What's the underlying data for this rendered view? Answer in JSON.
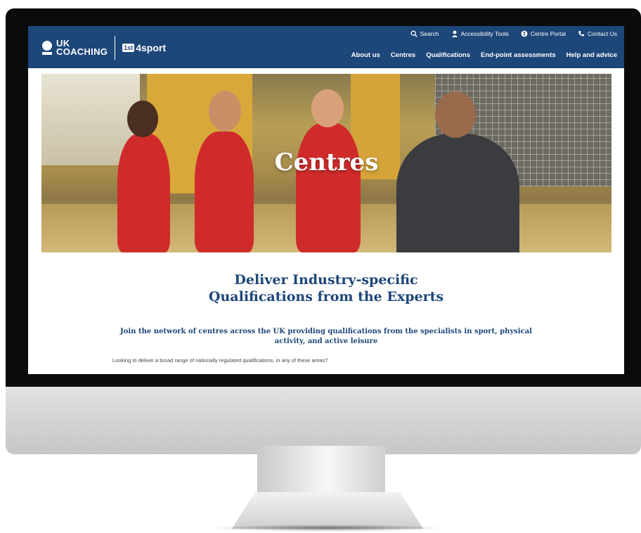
{
  "brand": {
    "uk_line1": "UK",
    "uk_line2": "COACHING",
    "badge": "1st",
    "name": "4sport"
  },
  "util_nav": [
    {
      "label": "Search",
      "icon": "search-icon"
    },
    {
      "label": "Accessibility Tools",
      "icon": "person-icon"
    },
    {
      "label": "Centre Portal",
      "icon": "globe-icon"
    },
    {
      "label": "Contact Us",
      "icon": "phone-icon"
    }
  ],
  "main_nav": [
    "About us",
    "Centres",
    "Qualifications",
    "End-point assessments",
    "Help and advice"
  ],
  "hero": {
    "title": "Centres"
  },
  "content": {
    "headline_line1": "Deliver Industry-specific",
    "headline_line2": "Qualifications from the Experts",
    "subhead": "Join the network of centres across the UK providing qualifications from the specialists in sport, physical activity, and active leisure",
    "body": "Looking to deliver a broad range of nationally regulated qualifications, in any of these areas?"
  },
  "colors": {
    "brand_blue": "#1d4679",
    "jersey_red": "#d02b2b"
  }
}
